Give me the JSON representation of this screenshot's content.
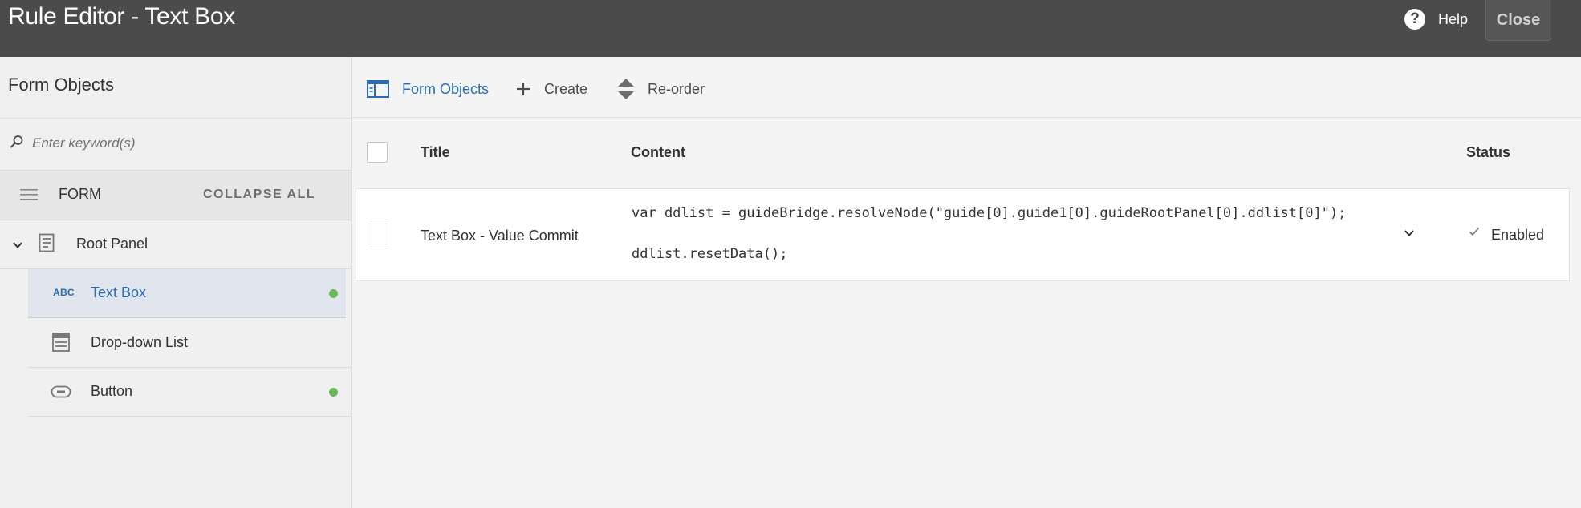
{
  "header": {
    "title": "Rule Editor - Text Box",
    "help_icon": "?",
    "help_label": "Help",
    "close_label": "Close"
  },
  "sidebar": {
    "title": "Form Objects",
    "search_placeholder": "Enter keyword(s)",
    "form_label": "FORM",
    "collapse_label": "COLLAPSE ALL",
    "items": [
      {
        "label": "Root Panel",
        "icon": "panel-icon"
      },
      {
        "label": "Text Box",
        "icon": "abc-icon",
        "abc": "ABC",
        "has_rule": true,
        "selected": true
      },
      {
        "label": "Drop-down List",
        "icon": "list-icon"
      },
      {
        "label": "Button",
        "icon": "button-icon",
        "has_rule": true
      }
    ]
  },
  "toolbar": {
    "form_objects_label": "Form Objects",
    "create_label": "Create",
    "reorder_label": "Re-order"
  },
  "table": {
    "columns": {
      "title": "Title",
      "content": "Content",
      "status": "Status"
    },
    "rows": [
      {
        "title": "Text Box - Value Commit",
        "content_line1": "var ddlist = guideBridge.resolveNode(\"guide[0].guide1[0].guideRootPanel[0].ddlist[0]\");",
        "content_line2": "ddlist.resetData();",
        "status": "Enabled"
      }
    ]
  },
  "colors": {
    "header_bg": "#4b4b4b",
    "accent_blue": "#2c6bb3",
    "rule_dot_green": "#6bb85a",
    "selected_row_bg": "#e1e6ee"
  }
}
